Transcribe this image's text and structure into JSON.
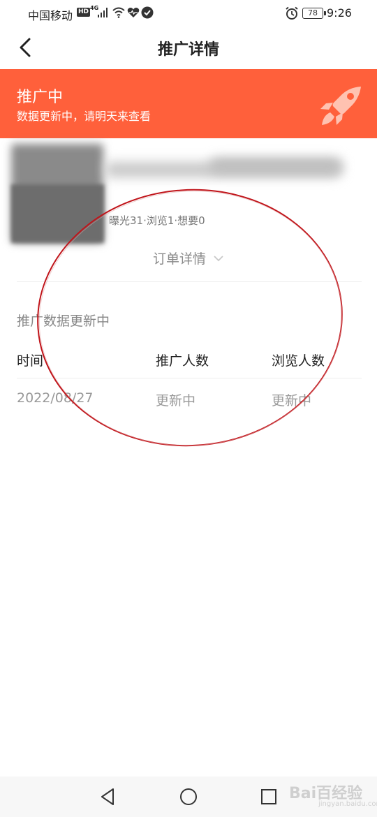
{
  "status_bar": {
    "carrier": "中国移动",
    "hd": "HD",
    "network": "4G",
    "battery": "78",
    "time": "9:26"
  },
  "header": {
    "title": "推广详情",
    "back_icon": "chevron-left-icon"
  },
  "banner": {
    "status": "推广中",
    "subtitle": "数据更新中，请明天来查看",
    "icon": "rocket-icon",
    "color": "#ff603b"
  },
  "product": {
    "stats": "曝光31·浏览1·想要0"
  },
  "order_toggle": {
    "label": "订单详情"
  },
  "promo_data": {
    "title": "推广数据更新中",
    "columns": [
      "时间",
      "推广人数",
      "浏览人数"
    ],
    "rows": [
      [
        "2022/08/27",
        "更新中",
        "更新中"
      ]
    ]
  },
  "watermark": {
    "text": "Bai百经验",
    "sub": "jingyan.baidu.com"
  }
}
